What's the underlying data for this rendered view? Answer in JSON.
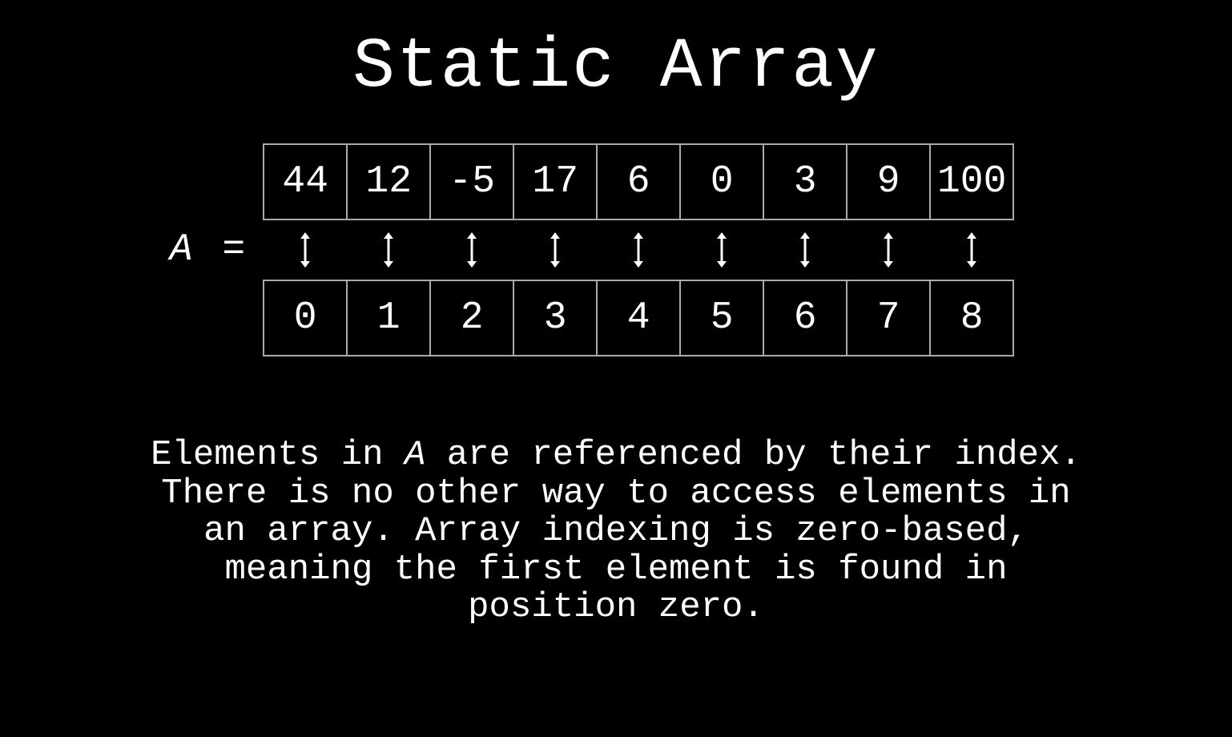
{
  "title": "Static Array",
  "array": {
    "label_var": "A",
    "label_eq": " = ",
    "values": [
      "44",
      "12",
      "-5",
      "17",
      "6",
      "0",
      "3",
      "9",
      "100"
    ],
    "indices": [
      "0",
      "1",
      "2",
      "3",
      "4",
      "5",
      "6",
      "7",
      "8"
    ]
  },
  "explain": {
    "p1a": "Elements in ",
    "p1var": "A",
    "p1b": " are referenced by their index. There is no other way to access elements in an array. Array indexing is zero-based, meaning the first element is found in position zero."
  }
}
